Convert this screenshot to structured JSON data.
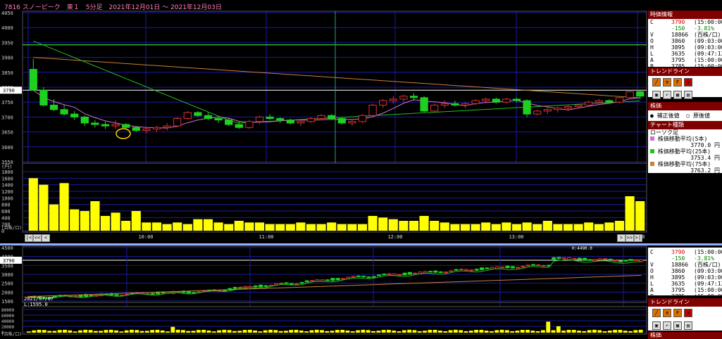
{
  "header": {
    "title": "7816 スノーピーク　東１　5分足　2021年12月01日 ～ 2021年12月03日"
  },
  "colors": {
    "grid": "#1a1aa6",
    "price_line": "#ffffff",
    "ma5": "#d070d0",
    "ma25": "#20c020",
    "ma75": "#c8803a",
    "candle_up_border": "#e03030",
    "candle_down": "#20d020",
    "volume": "#ffff00",
    "crosshair": "#22aa66",
    "hline_green": "#40ff40"
  },
  "main_chart": {
    "y_ticks": [
      "4050",
      "4000",
      "3950",
      "3900",
      "3850",
      "3800",
      "3750",
      "3700",
      "3650",
      "3600",
      "3550"
    ],
    "current_price_tag": "3790",
    "vol_unit_label": "(円)",
    "vol_ticks": [
      "1800",
      "1600",
      "1400",
      "1200",
      "1000",
      "800",
      "600",
      "400",
      "200",
      "0"
    ],
    "vol_axis_label": "(百株/口)",
    "x_ticks": [
      "09:00",
      "10:00",
      "11:00",
      "12:00",
      "13:00",
      "14:00",
      "15:00"
    ],
    "nav_buttons": [
      "|<",
      "<<",
      "<",
      ">",
      ">>",
      ">|"
    ]
  },
  "chart_data": [
    {
      "type": "candlestick",
      "title": "7816 スノーピーク 5分足",
      "ylim": [
        3550,
        4050
      ],
      "current_price": 3790,
      "x_ticks": [
        "09:00",
        "10:00",
        "11:00",
        "12:00",
        "13:00",
        "14:00",
        "15:00"
      ],
      "candles": [
        [
          3860,
          3895,
          3790,
          3790
        ],
        [
          3790,
          3800,
          3735,
          3740
        ],
        [
          3740,
          3760,
          3720,
          3725
        ],
        [
          3725,
          3740,
          3705,
          3710
        ],
        [
          3710,
          3720,
          3690,
          3700
        ],
        [
          3700,
          3705,
          3670,
          3680
        ],
        [
          3680,
          3690,
          3665,
          3675
        ],
        [
          3675,
          3685,
          3660,
          3670
        ],
        [
          3670,
          3690,
          3660,
          3675
        ],
        [
          3675,
          3680,
          3660,
          3665
        ],
        [
          3665,
          3670,
          3650,
          3655
        ],
        [
          3655,
          3665,
          3645,
          3660
        ],
        [
          3660,
          3670,
          3650,
          3665
        ],
        [
          3665,
          3680,
          3655,
          3670
        ],
        [
          3670,
          3700,
          3665,
          3695
        ],
        [
          3695,
          3720,
          3690,
          3715
        ],
        [
          3715,
          3720,
          3700,
          3705
        ],
        [
          3705,
          3715,
          3690,
          3695
        ],
        [
          3695,
          3700,
          3680,
          3690
        ],
        [
          3690,
          3695,
          3670,
          3675
        ],
        [
          3675,
          3685,
          3660,
          3665
        ],
        [
          3665,
          3690,
          3660,
          3685
        ],
        [
          3685,
          3705,
          3675,
          3700
        ],
        [
          3700,
          3710,
          3690,
          3695
        ],
        [
          3695,
          3700,
          3680,
          3690
        ],
        [
          3690,
          3695,
          3675,
          3680
        ],
        [
          3680,
          3690,
          3670,
          3685
        ],
        [
          3685,
          3700,
          3680,
          3695
        ],
        [
          3695,
          3710,
          3690,
          3705
        ],
        [
          3705,
          3710,
          3690,
          3695
        ],
        [
          3695,
          3700,
          3675,
          3680
        ],
        [
          3680,
          3690,
          3670,
          3685
        ],
        [
          3685,
          3710,
          3680,
          3705
        ],
        [
          3705,
          3745,
          3700,
          3740
        ],
        [
          3740,
          3760,
          3730,
          3755
        ],
        [
          3755,
          3770,
          3745,
          3760
        ],
        [
          3760,
          3775,
          3750,
          3770
        ],
        [
          3770,
          3780,
          3755,
          3765
        ],
        [
          3765,
          3770,
          3715,
          3720
        ],
        [
          3720,
          3745,
          3715,
          3740
        ],
        [
          3740,
          3755,
          3730,
          3745
        ],
        [
          3745,
          3755,
          3735,
          3740
        ],
        [
          3740,
          3750,
          3730,
          3745
        ],
        [
          3745,
          3760,
          3740,
          3755
        ],
        [
          3755,
          3765,
          3745,
          3760
        ],
        [
          3760,
          3765,
          3745,
          3750
        ],
        [
          3750,
          3765,
          3745,
          3760
        ],
        [
          3760,
          3765,
          3750,
          3755
        ],
        [
          3755,
          3760,
          3700,
          3710
        ],
        [
          3710,
          3725,
          3705,
          3720
        ],
        [
          3720,
          3730,
          3710,
          3725
        ],
        [
          3725,
          3735,
          3715,
          3730
        ],
        [
          3730,
          3740,
          3720,
          3735
        ],
        [
          3735,
          3745,
          3730,
          3740
        ],
        [
          3740,
          3755,
          3735,
          3750
        ],
        [
          3750,
          3760,
          3745,
          3755
        ],
        [
          3755,
          3760,
          3745,
          3750
        ],
        [
          3750,
          3770,
          3745,
          3765
        ],
        [
          3765,
          3790,
          3760,
          3785
        ],
        [
          3785,
          3790,
          3760,
          3770
        ]
      ],
      "volume": [
        1600,
        1400,
        800,
        1450,
        650,
        600,
        900,
        450,
        550,
        300,
        600,
        250,
        250,
        200,
        250,
        200,
        350,
        350,
        250,
        200,
        300,
        250,
        250,
        200,
        200,
        200,
        250,
        200,
        200,
        250,
        200,
        200,
        200,
        450,
        400,
        350,
        300,
        300,
        450,
        300,
        250,
        200,
        200,
        200,
        250,
        200,
        250,
        200,
        250,
        200,
        300,
        200,
        200,
        200,
        250,
        200,
        250,
        300,
        1050,
        900
      ],
      "series": [
        {
          "name": "株価移動平均(5本)",
          "last": "3770.0 円"
        },
        {
          "name": "株価移動平均(25本)",
          "last": "3753.4 円"
        },
        {
          "name": "株価移動平均(75本)",
          "last": "3763.2 円"
        }
      ]
    },
    {
      "type": "candlestick",
      "title": "daily overview",
      "ylim": [
        1500,
        4500
      ],
      "annotations": [
        "2021/07/07",
        "L:1595.0",
        "H:4490.0"
      ],
      "y_ticks": [
        "4500",
        "4000",
        "3500",
        "3000",
        "2500",
        "2000",
        "1500"
      ],
      "vol_ticks": [
        "80000",
        "60000",
        "40000",
        "20000",
        "0"
      ],
      "vol_axis_label": "(百株/口)"
    }
  ],
  "side_panel": {
    "info_header": "時価情報",
    "info_rows": [
      {
        "k": "C",
        "v": "3790",
        "t": "(15:00:00)",
        "color": "red"
      },
      {
        "k": "",
        "v": "-150",
        "t": "-3.81%",
        "color": "green"
      },
      {
        "k": "V",
        "v": "18866",
        "t": "(百株/口)",
        "color": ""
      },
      {
        "k": "O",
        "v": "3860",
        "t": "(09:03:00)",
        "color": ""
      },
      {
        "k": "H",
        "v": "3895",
        "t": "(09:03:00)",
        "color": ""
      },
      {
        "k": "L",
        "v": "3635",
        "t": "(09:47:13)",
        "color": ""
      },
      {
        "k": "A",
        "v": "3795",
        "t": "(15:00:00)",
        "color": ""
      },
      {
        "k": "B",
        "v": "3785",
        "t": "(15:00:00)",
        "color": ""
      },
      {
        "k": "PC",
        "v": "3940",
        "t": "(12/02)",
        "color": ""
      }
    ],
    "trendline_header": "トレンドライン",
    "kabuka_header": "株価",
    "radio1": "補正後値",
    "radio2": "原後値",
    "chart_kind_header": "チャート種類",
    "chart_kind": "ローソク足",
    "ma5_label": "株価移動平均(5本)",
    "ma5_value": "3770.0 円",
    "ma25_label": "株価移動平均(25本)",
    "ma25_value": "3753.4 円",
    "ma75_label": "株価移動平均(75本)",
    "ma75_value": "3763.2 円",
    "bottom_label": "株価"
  }
}
